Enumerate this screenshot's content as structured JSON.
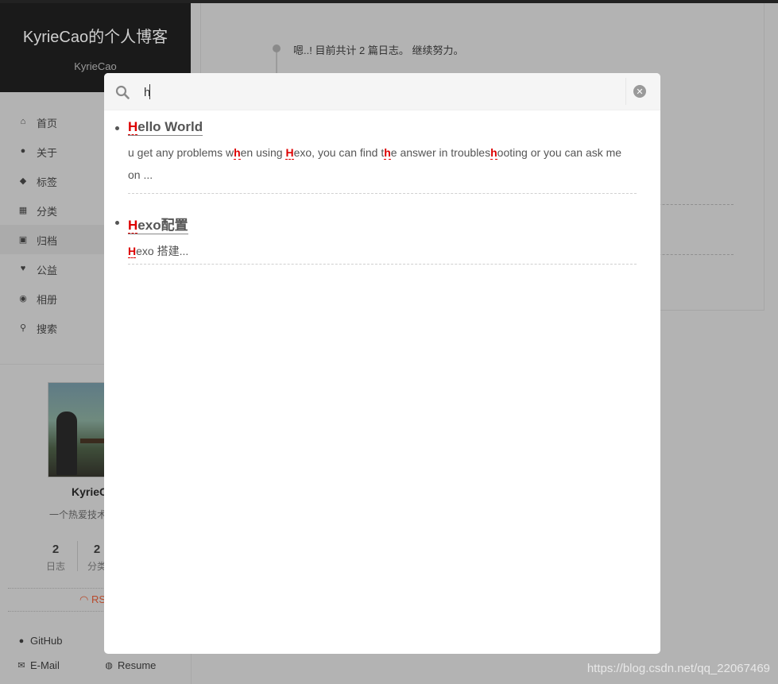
{
  "site": {
    "title": "KyrieCao的个人博客",
    "subtitle": "KyrieCao"
  },
  "menu": {
    "items": [
      {
        "label": "首页",
        "icon": "home-icon",
        "glyph": "⌂"
      },
      {
        "label": "关于",
        "icon": "user-icon",
        "glyph": "●"
      },
      {
        "label": "标签",
        "icon": "tags-icon",
        "glyph": "◆"
      },
      {
        "label": "分类",
        "icon": "grid-icon",
        "glyph": "▦"
      },
      {
        "label": "归档",
        "icon": "archive-icon",
        "glyph": "▣"
      },
      {
        "label": "公益",
        "icon": "heartbeat-icon",
        "glyph": "♥"
      },
      {
        "label": "相册",
        "icon": "camera-icon",
        "glyph": "◉"
      },
      {
        "label": "搜索",
        "icon": "search-icon",
        "glyph": "⚲"
      }
    ]
  },
  "profile": {
    "name": "KyrieC",
    "description": "一个热爱技术",
    "stats": [
      {
        "count": "2",
        "label": "日志"
      },
      {
        "count": "2",
        "label": "分类"
      }
    ],
    "rss_label": "RS",
    "links": [
      {
        "label": "GitHub",
        "icon": "github-icon"
      },
      {
        "label": "E-Mail",
        "icon": "envelope-icon"
      },
      {
        "label": "Resume",
        "icon": "globe-icon"
      }
    ]
  },
  "archive": {
    "message": "嗯..! 目前共计 2 篇日志。 继续努力。"
  },
  "search": {
    "query": "h",
    "results": [
      {
        "title_hl": "H",
        "title_rest": "ello World",
        "excerpt": [
          {
            "t": "u get any problems w"
          },
          {
            "h": "h"
          },
          {
            "t": "en using "
          },
          {
            "h": "H"
          },
          {
            "t": "exo, you can find t"
          },
          {
            "h": "h"
          },
          {
            "t": "e answer in troubles"
          },
          {
            "h": "h"
          },
          {
            "t": "ooting or you can ask me on ..."
          }
        ]
      },
      {
        "title_hl": "H",
        "title_rest": "exo配置",
        "excerpt": [
          {
            "h": "H"
          },
          {
            "t": "exo 搭建..."
          }
        ]
      }
    ]
  },
  "watermark": "https://blog.csdn.net/qq_22067469"
}
